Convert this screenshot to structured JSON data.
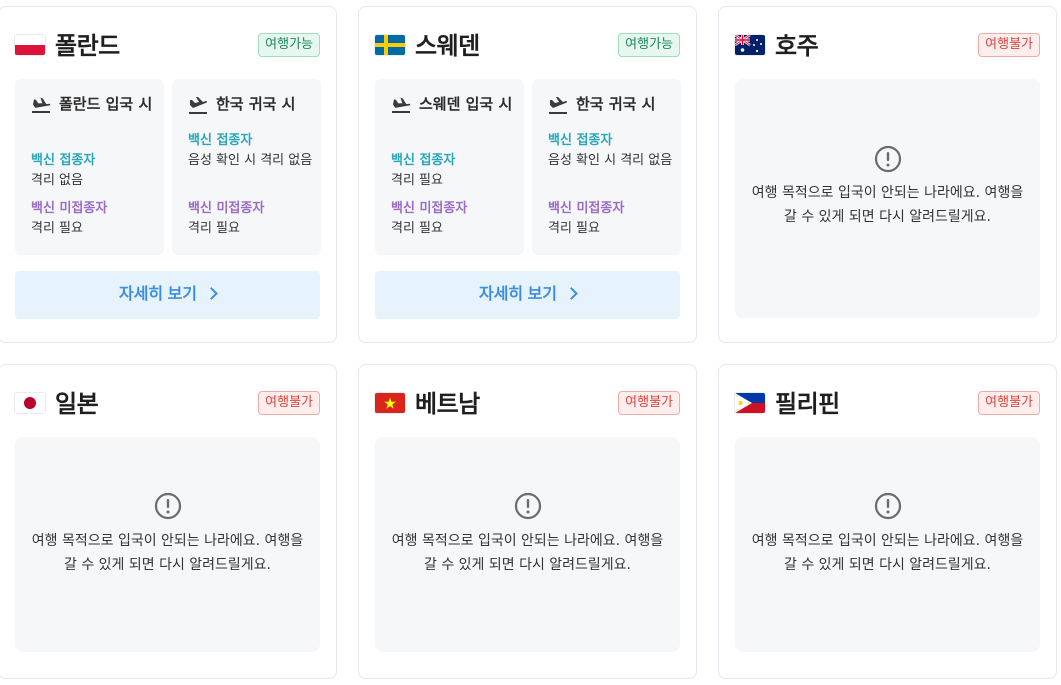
{
  "ui": {
    "details_button_label": "자세히 보기",
    "notice_text": "여행 목적으로 입국이 안되는 나라에요. 여행을 갈 수 있게 되면 다시 알려드릴게요.",
    "vaccinated_label": "백신 접종자",
    "unvaccinated_label": "백신 미접종자",
    "colors": {
      "available": "#1a8a5a",
      "unavailable": "#d9473f",
      "vaccinated": "#2aa6bc",
      "unvaccinated": "#9b6bc5",
      "button_text": "#3c8ee0"
    }
  },
  "countries": [
    {
      "name": "폴란드",
      "flag": "flag-poland-icon",
      "status": "여행가능",
      "entry": {
        "title": "폴란드 입국 시",
        "vaccinated": "격리 없음",
        "unvaccinated": "격리 필요"
      },
      "return": {
        "title": "한국 귀국 시",
        "vaccinated": "음성 확인 시 격리 없음",
        "unvaccinated": "격리 필요"
      }
    },
    {
      "name": "스웨덴",
      "flag": "flag-sweden-icon",
      "status": "여행가능",
      "entry": {
        "title": "스웨덴 입국 시",
        "vaccinated": "격리 필요",
        "unvaccinated": "격리 필요"
      },
      "return": {
        "title": "한국 귀국 시",
        "vaccinated": "음성 확인 시 격리 없음",
        "unvaccinated": "격리 필요"
      }
    },
    {
      "name": "호주",
      "flag": "flag-australia-icon",
      "status": "여행불가"
    },
    {
      "name": "일본",
      "flag": "flag-japan-icon",
      "status": "여행불가"
    },
    {
      "name": "베트남",
      "flag": "flag-vietnam-icon",
      "status": "여행불가"
    },
    {
      "name": "필리핀",
      "flag": "flag-philippines-icon",
      "status": "여행불가"
    }
  ]
}
